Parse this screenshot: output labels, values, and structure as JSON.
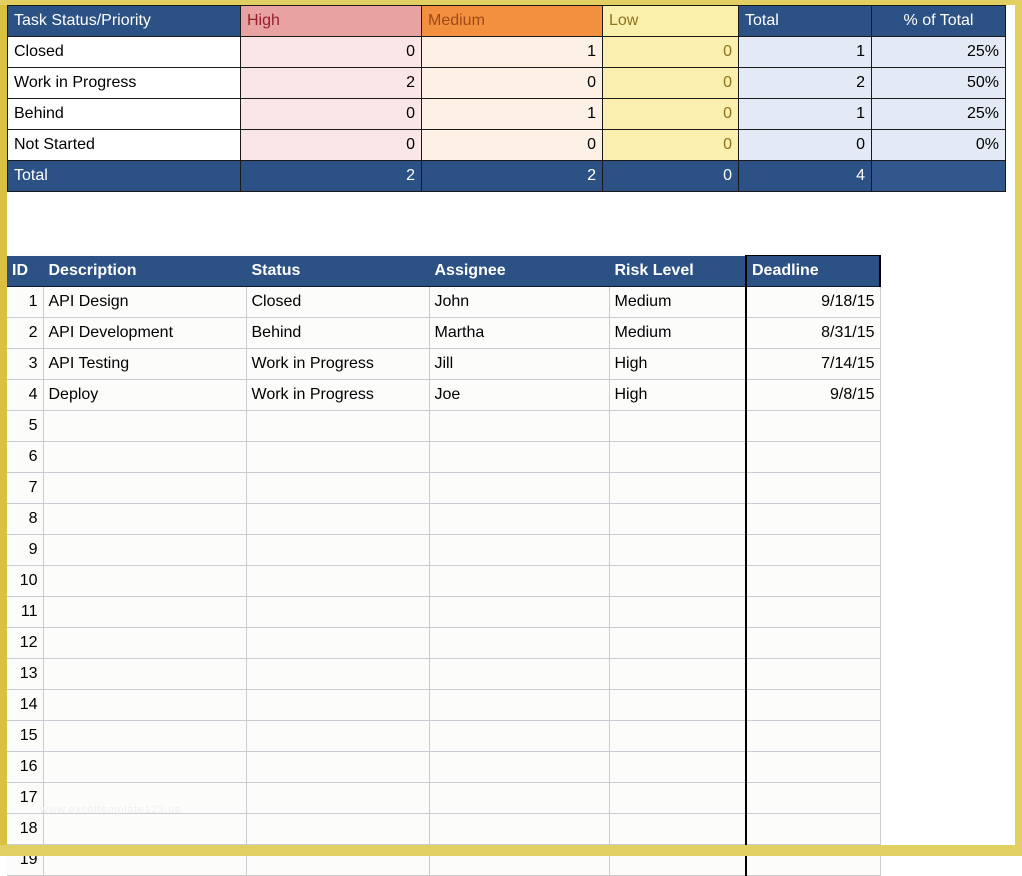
{
  "summary": {
    "headers": {
      "label": "Task Status/Priority",
      "high": "High",
      "medium": "Medium",
      "low": "Low",
      "total": "Total",
      "pct": "% of Total"
    },
    "rows": [
      {
        "label": "Closed",
        "high": "0",
        "medium": "1",
        "low": "0",
        "total": "1",
        "pct": "25%"
      },
      {
        "label": "Work in Progress",
        "high": "2",
        "medium": "0",
        "low": "0",
        "total": "2",
        "pct": "50%"
      },
      {
        "label": "Behind",
        "high": "0",
        "medium": "1",
        "low": "0",
        "total": "1",
        "pct": "25%"
      },
      {
        "label": "Not Started",
        "high": "0",
        "medium": "0",
        "low": "0",
        "total": "0",
        "pct": "0%"
      }
    ],
    "total_row": {
      "label": "Total",
      "high": "2",
      "medium": "2",
      "low": "0",
      "total": "4",
      "pct": ""
    }
  },
  "detail": {
    "headers": {
      "id": "ID",
      "description": "Description",
      "status": "Status",
      "assignee": "Assignee",
      "risk": "Risk Level",
      "deadline": "Deadline"
    },
    "rows": [
      {
        "id": "1",
        "description": "API Design",
        "status": "Closed",
        "assignee": "John",
        "risk": "Medium",
        "risk_level": "medium",
        "deadline": "9/18/15"
      },
      {
        "id": "2",
        "description": "API Development",
        "status": "Behind",
        "assignee": "Martha",
        "risk": "Medium",
        "risk_level": "medium",
        "deadline": "8/31/15"
      },
      {
        "id": "3",
        "description": "API Testing",
        "status": "Work in Progress",
        "assignee": "Jill",
        "risk": "High",
        "risk_level": "high",
        "deadline": "7/14/15"
      },
      {
        "id": "4",
        "description": "Deploy",
        "status": "Work in Progress",
        "assignee": "Joe",
        "risk": "High",
        "risk_level": "high",
        "deadline": "9/8/15"
      },
      {
        "id": "5",
        "description": "",
        "status": "",
        "assignee": "",
        "risk": "",
        "risk_level": "none",
        "deadline": ""
      },
      {
        "id": "6",
        "description": "",
        "status": "",
        "assignee": "",
        "risk": "",
        "risk_level": "none",
        "deadline": ""
      },
      {
        "id": "7",
        "description": "",
        "status": "",
        "assignee": "",
        "risk": "",
        "risk_level": "none",
        "deadline": ""
      },
      {
        "id": "8",
        "description": "",
        "status": "",
        "assignee": "",
        "risk": "",
        "risk_level": "none",
        "deadline": ""
      },
      {
        "id": "9",
        "description": "",
        "status": "",
        "assignee": "",
        "risk": "",
        "risk_level": "none",
        "deadline": ""
      },
      {
        "id": "10",
        "description": "",
        "status": "",
        "assignee": "",
        "risk": "",
        "risk_level": "none",
        "deadline": ""
      },
      {
        "id": "11",
        "description": "",
        "status": "",
        "assignee": "",
        "risk": "",
        "risk_level": "none",
        "deadline": ""
      },
      {
        "id": "12",
        "description": "",
        "status": "",
        "assignee": "",
        "risk": "",
        "risk_level": "none",
        "deadline": ""
      },
      {
        "id": "13",
        "description": "",
        "status": "",
        "assignee": "",
        "risk": "",
        "risk_level": "none",
        "deadline": ""
      },
      {
        "id": "14",
        "description": "",
        "status": "",
        "assignee": "",
        "risk": "",
        "risk_level": "none",
        "deadline": ""
      },
      {
        "id": "15",
        "description": "",
        "status": "",
        "assignee": "",
        "risk": "",
        "risk_level": "none",
        "deadline": ""
      },
      {
        "id": "16",
        "description": "",
        "status": "",
        "assignee": "",
        "risk": "",
        "risk_level": "none",
        "deadline": ""
      },
      {
        "id": "17",
        "description": "",
        "status": "",
        "assignee": "",
        "risk": "",
        "risk_level": "none",
        "deadline": ""
      },
      {
        "id": "18",
        "description": "",
        "status": "",
        "assignee": "",
        "risk": "",
        "risk_level": "none",
        "deadline": ""
      },
      {
        "id": "19",
        "description": "",
        "status": "",
        "assignee": "",
        "risk": "",
        "risk_level": "none",
        "deadline": ""
      }
    ]
  },
  "watermark": "www.exceltemplate123.us",
  "colors": {
    "header_navy": "#2c5185",
    "high_header": "#e8a2a2",
    "high_text": "#96202c",
    "medium_header": "#f2903f",
    "medium_text": "#9d4b16",
    "low_header": "#fbf0ab",
    "low_text": "#8c7420",
    "total_tint": "#e3eaf5",
    "frame_gold": "#d9c040",
    "risk_medium_bg": "#f8c68a",
    "risk_high_bg": "#fbd3d8"
  }
}
